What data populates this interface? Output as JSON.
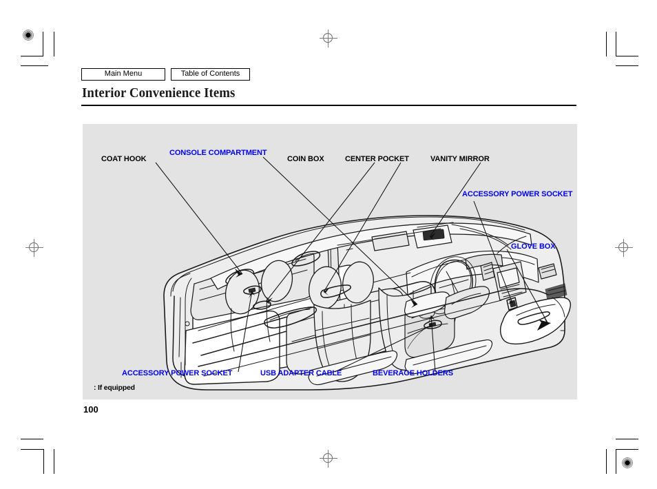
{
  "nav": {
    "main_menu": "Main Menu",
    "table_of_contents": "Table of Contents"
  },
  "header": {
    "title": "Interior Convenience Items"
  },
  "figure": {
    "note": ": If equipped",
    "background_color": "#e3e3e3",
    "callout_black_color": "#000000",
    "callout_blue_color": "#0000f5",
    "callouts": [
      {
        "label": "COAT HOOK",
        "color": "black"
      },
      {
        "label": "CONSOLE COMPARTMENT",
        "color": "blue"
      },
      {
        "label": "COIN BOX",
        "color": "black"
      },
      {
        "label": "CENTER POCKET",
        "color": "black"
      },
      {
        "label": "VANITY MIRROR",
        "color": "black"
      },
      {
        "label": "ACCESSORY POWER SOCKET",
        "color": "blue"
      },
      {
        "label": "GLOVE BOX",
        "color": "blue"
      },
      {
        "label": "ACCESSORY POWER SOCKET",
        "color": "blue"
      },
      {
        "label": "USB ADAPTER CABLE",
        "color": "blue"
      },
      {
        "label": "BEVERAGE HOLDERS",
        "color": "blue"
      }
    ]
  },
  "footer": {
    "page_number": "100"
  }
}
